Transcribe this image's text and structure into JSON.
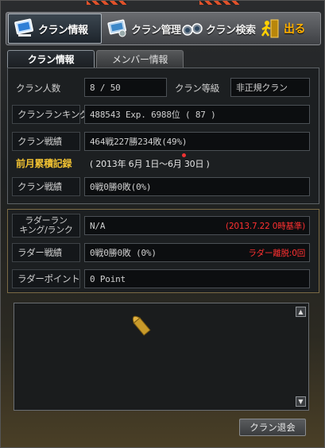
{
  "nav": {
    "clan_info": "クラン情報",
    "clan_manage": "クラン管理",
    "clan_search": "クラン検索",
    "exit": "出る"
  },
  "tabs": {
    "clan_info": "クラン情報",
    "member_info": "メンバー情報"
  },
  "clan": {
    "members_label": "クラン人数",
    "members_value": "8 / 50",
    "rank_label": "クラン等級",
    "rank_value": "非正規クラン",
    "ranking_label": "クランランキング",
    "ranking_value": "488543 Exp. 6988位 ( 87 )",
    "record_label": "クラン戦績",
    "record_value": "464戦227勝234敗(49%)"
  },
  "last_month": {
    "title": "前月累積記録",
    "range": "( 2013年 6月 1日～6月 30日 )",
    "record_label": "クラン戦績",
    "record_value": "0戦0勝0敗(0%)"
  },
  "ladder": {
    "ranking_label_1": "ラダーラン",
    "ranking_label_2": "キング/ランク",
    "ranking_value": "N/A",
    "ranking_note": "(2013.7.22 0時基準)",
    "record_label": "ラダー戦績",
    "record_value": "0戦0勝0敗 (0%)",
    "leave_note": "ラダー離脱:0回",
    "points_label": "ラダーポイント",
    "points_value": "0 Point"
  },
  "buttons": {
    "withdraw": "クラン退会"
  },
  "colors": {
    "accent_gold": "#f1c232",
    "alert_red": "#ff3030",
    "exit_orange": "#ffb000"
  }
}
